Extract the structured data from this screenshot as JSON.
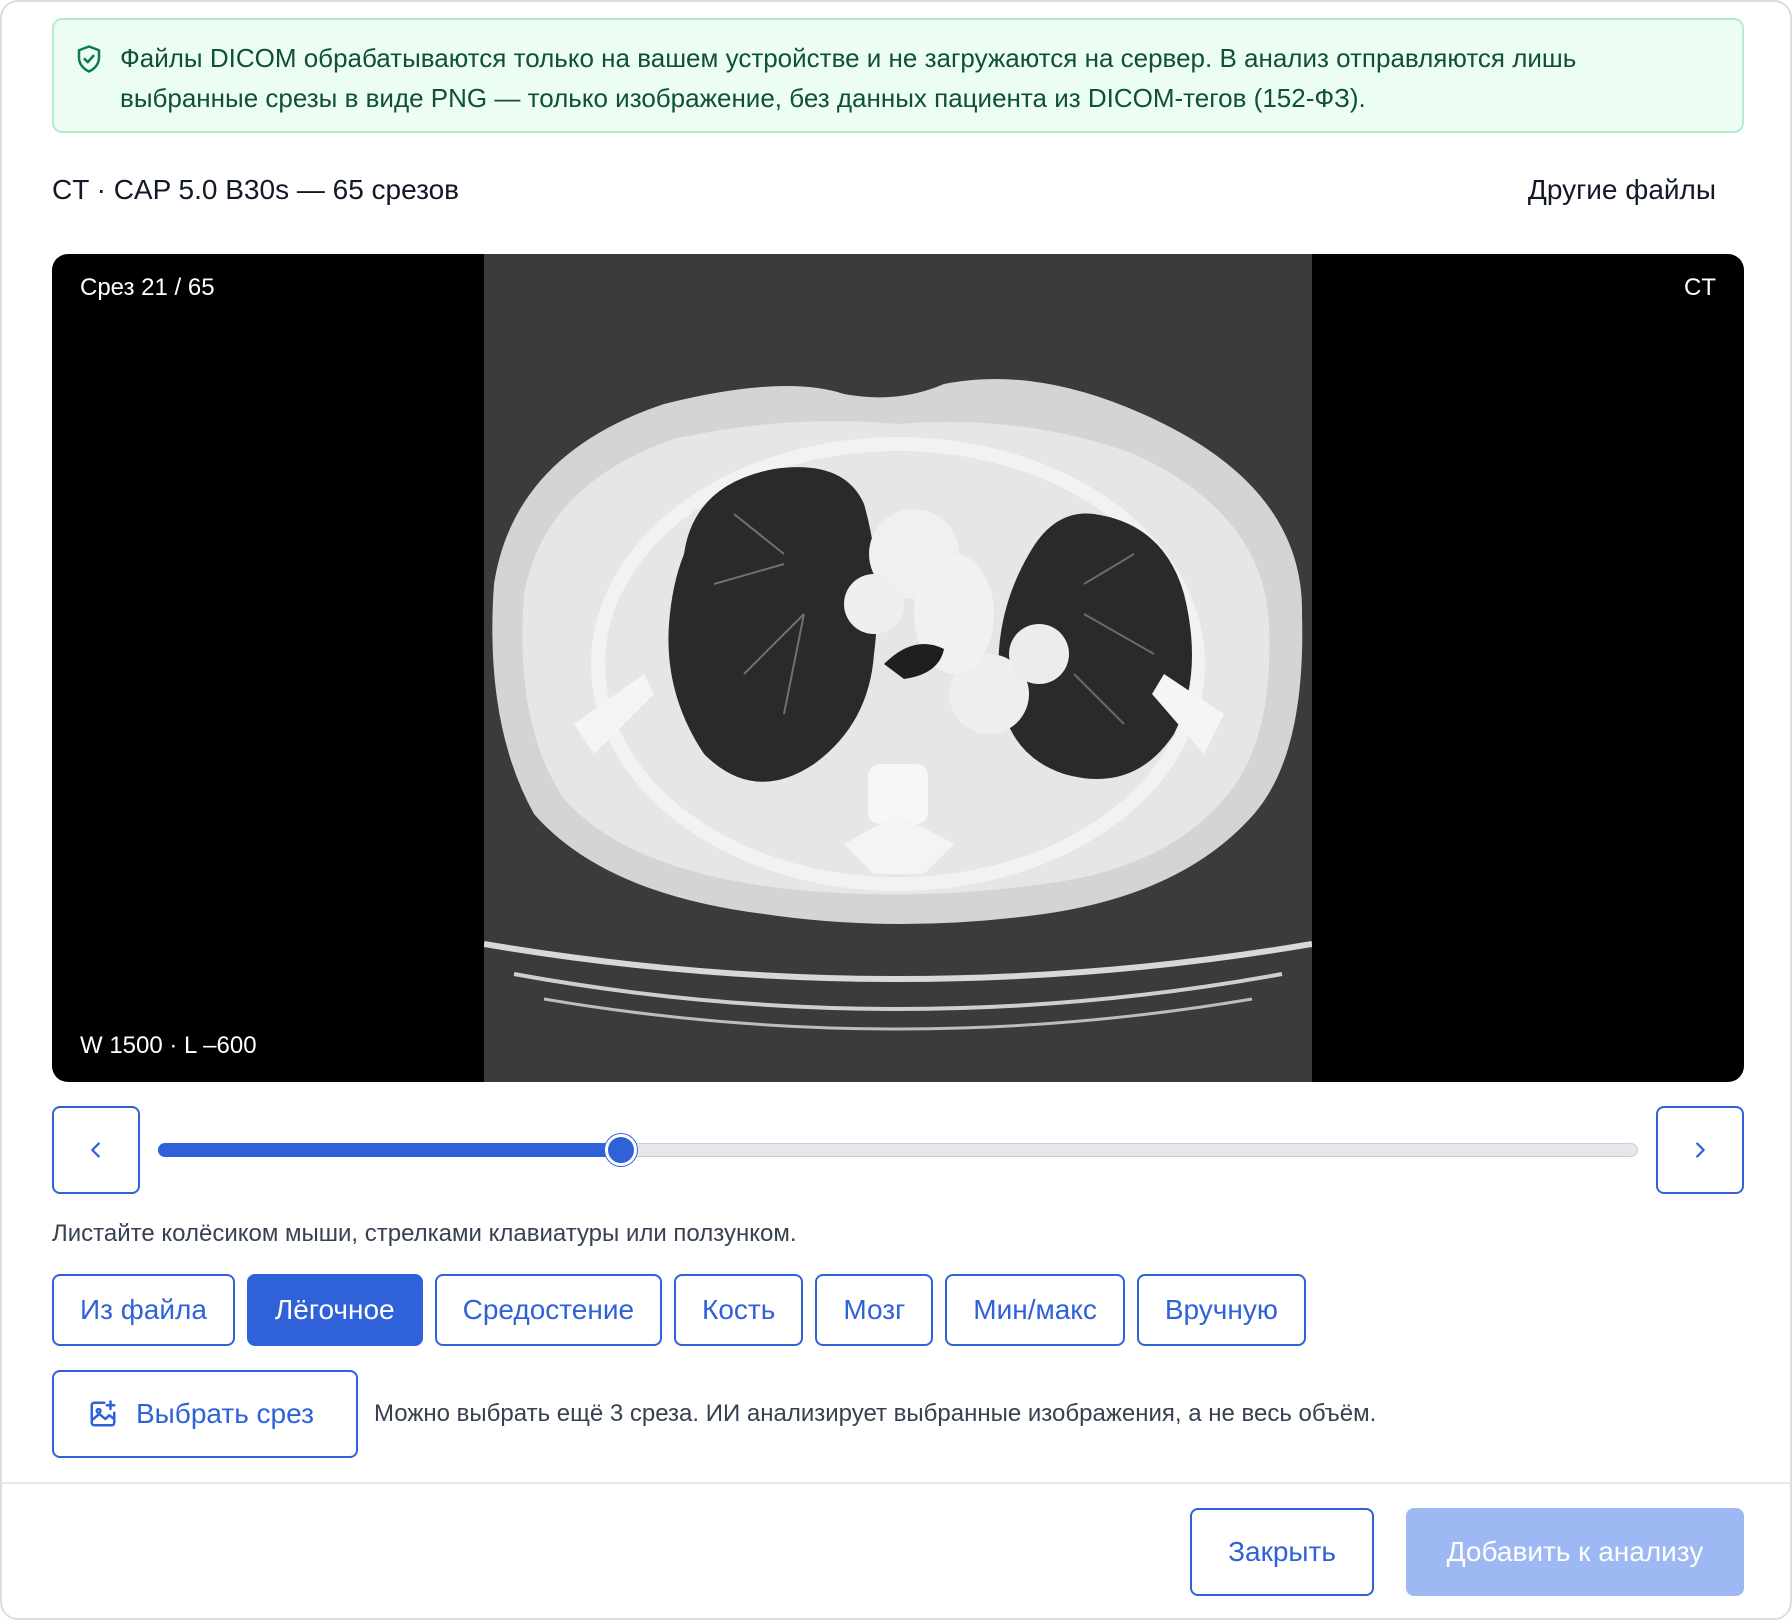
{
  "notice": {
    "text": "Файлы DICOM обрабатываются только на вашем устройстве и не загружаются на сервер. В анализ отправляются лишь выбранные срезы в виде PNG — только изображение, без данных пациента из DICOM-тегов (152-ФЗ)."
  },
  "file": {
    "title": "CT · CAP 5.0 B30s — 65 срезов",
    "other_files_label": "Другие файлы"
  },
  "viewer": {
    "slice_label": "Срез 21 / 65",
    "modality": "CT",
    "window_level": "W 1500 · L –600",
    "current_slice": 21,
    "total_slices": 65
  },
  "hint": "Листайте колёсиком мыши, стрелками клавиатуры или ползунком.",
  "presets": [
    {
      "label": "Из файла",
      "active": false
    },
    {
      "label": "Лёгочное",
      "active": true
    },
    {
      "label": "Средостение",
      "active": false
    },
    {
      "label": "Кость",
      "active": false
    },
    {
      "label": "Мозг",
      "active": false
    },
    {
      "label": "Мин/макс",
      "active": false
    },
    {
      "label": "Вручную",
      "active": false
    }
  ],
  "select": {
    "button_label": "Выбрать срез",
    "note": "Можно выбрать ещё 3 среза. ИИ анализирует выбранные изображения, а не весь объём."
  },
  "footer": {
    "close_label": "Закрыть",
    "add_label": "Добавить к анализу"
  },
  "colors": {
    "accent": "#2f62d9",
    "notice_bg": "#ecfdf3",
    "notice_text": "#0f5132",
    "disabled_accent": "#9db8f2"
  }
}
